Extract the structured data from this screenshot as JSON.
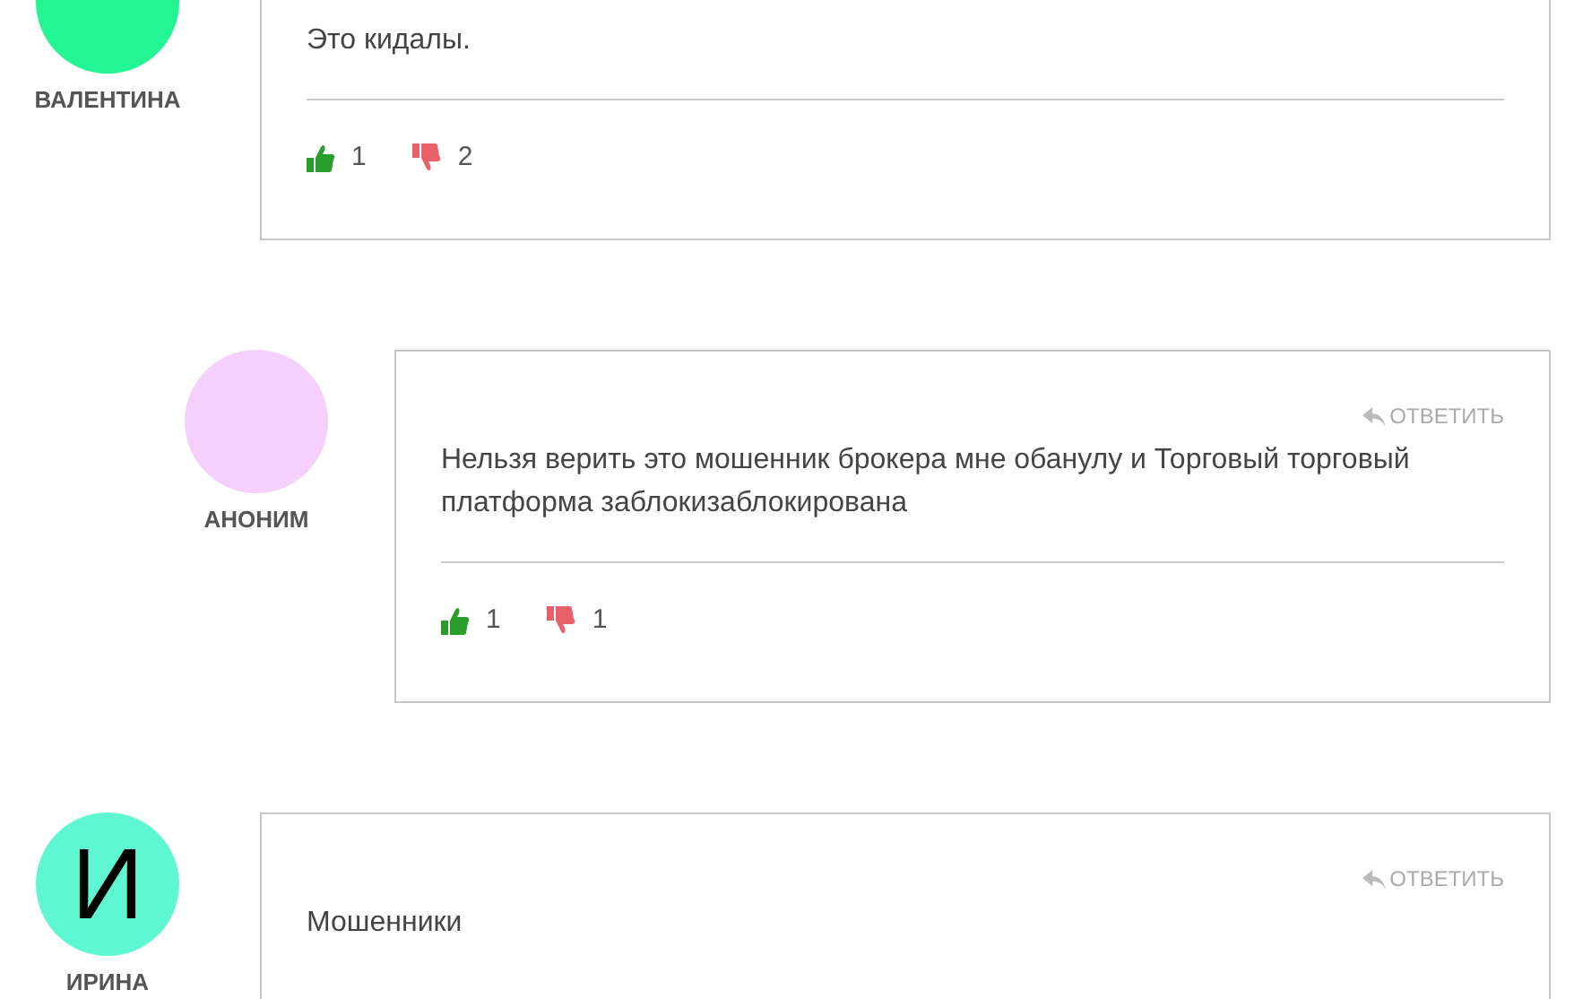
{
  "comments": [
    {
      "author": "ВАЛЕНТИНА",
      "color": "#22f592",
      "text": "Это кидалы.",
      "likes": "1",
      "dislikes": "2",
      "children": [
        {
          "author": "АНОНИМ",
          "color": "#f5d0fc",
          "reply": "ОТВЕТИТЬ",
          "text": "Нельзя верить это мошенник брокера мне обанулу и Торговый торговый платформа заблокизаблокирована",
          "likes": "1",
          "dislikes": "1"
        }
      ]
    },
    {
      "author": "ИРИНА",
      "avatar_letter": "И",
      "color": "#5ff7d2",
      "reply": "ОТВЕТИТЬ",
      "text": "Мошенники"
    }
  ]
}
